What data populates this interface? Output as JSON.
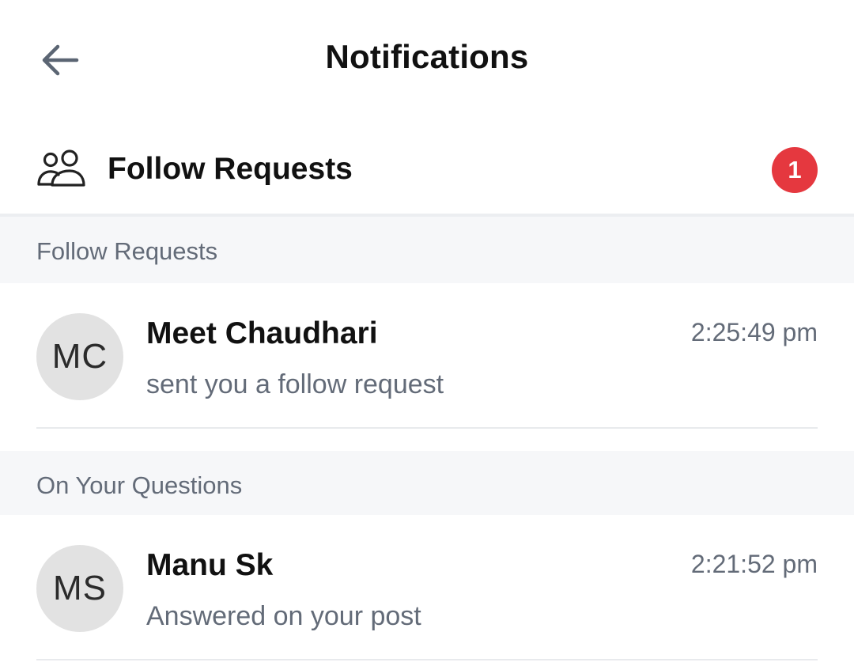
{
  "header": {
    "back_icon": "arrow-left-icon",
    "title": "Notifications"
  },
  "follow_requests_row": {
    "icon": "people-icon",
    "label": "Follow Requests",
    "badge_count": "1",
    "badge_color": "#e5383f"
  },
  "sections": [
    {
      "label": "Follow Requests",
      "items": [
        {
          "initials": "MC",
          "name": "Meet Chaudhari",
          "message": "sent you a follow request",
          "time": "2:25:49 pm"
        }
      ]
    },
    {
      "label": "On Your Questions",
      "items": [
        {
          "initials": "MS",
          "name": "Manu Sk",
          "message": "Answered on your post",
          "time": "2:21:52 pm"
        }
      ]
    }
  ]
}
